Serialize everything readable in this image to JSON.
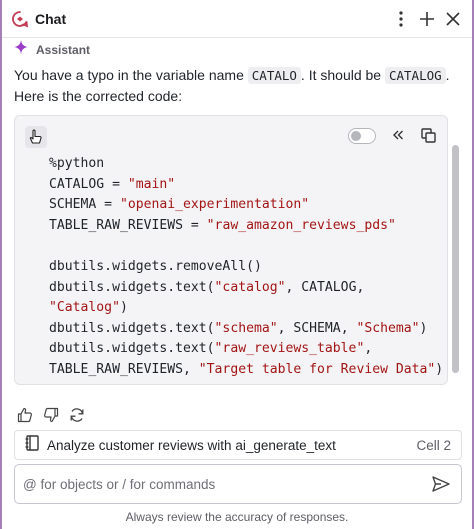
{
  "header": {
    "title": "Chat",
    "menu_icon": "more-vertical-icon",
    "new_chat_icon": "plus-icon",
    "close_icon": "close-icon"
  },
  "assistant": {
    "label": "Assistant",
    "icon": "sparkle-icon"
  },
  "message": {
    "text_before_1": "You have a typo in the variable name ",
    "code_1": "CATALO",
    "text_between": ". It should be ",
    "code_2": "CATALOG",
    "text_after": ". Here is the corrected code:"
  },
  "code_block": {
    "lines": [
      [
        {
          "t": "%python",
          "s": "plain"
        }
      ],
      [
        {
          "t": "CATALOG = ",
          "s": "plain"
        },
        {
          "t": "\"main\"",
          "s": "str"
        }
      ],
      [
        {
          "t": "SCHEMA = ",
          "s": "plain"
        },
        {
          "t": "\"openai_experimentation\"",
          "s": "str"
        }
      ],
      [
        {
          "t": "TABLE_RAW_REVIEWS = ",
          "s": "plain"
        },
        {
          "t": "\"raw_amazon_reviews_pds\"",
          "s": "str"
        }
      ],
      [
        {
          "t": "",
          "s": "plain"
        }
      ],
      [
        {
          "t": "dbutils.widgets.removeAll()",
          "s": "plain"
        }
      ],
      [
        {
          "t": "dbutils.widgets.text(",
          "s": "plain"
        },
        {
          "t": "\"catalog\"",
          "s": "str"
        },
        {
          "t": ", CATALOG,",
          "s": "plain"
        }
      ],
      [
        {
          "t": "\"Catalog\"",
          "s": "str"
        },
        {
          "t": ")",
          "s": "plain"
        }
      ],
      [
        {
          "t": "dbutils.widgets.text(",
          "s": "plain"
        },
        {
          "t": "\"schema\"",
          "s": "str"
        },
        {
          "t": ", SCHEMA, ",
          "s": "plain"
        },
        {
          "t": "\"Schema\"",
          "s": "str"
        },
        {
          "t": ")",
          "s": "plain"
        }
      ],
      [
        {
          "t": "dbutils.widgets.text(",
          "s": "plain"
        },
        {
          "t": "\"raw_reviews_table\"",
          "s": "str"
        },
        {
          "t": ",",
          "s": "plain"
        }
      ],
      [
        {
          "t": "TABLE_RAW_REVIEWS, ",
          "s": "plain"
        },
        {
          "t": "\"Target table for Review Data\"",
          "s": "str"
        },
        {
          "t": ")",
          "s": "plain"
        }
      ]
    ],
    "toggle_state": "off",
    "insert_icon": "insert-cursor-icon",
    "collapse_icon": "double-chevron-left-icon",
    "copy_icon": "copy-icon"
  },
  "feedback": {
    "thumbs_up_icon": "thumbs-up-icon",
    "thumbs_down_icon": "thumbs-down-icon",
    "regenerate_icon": "refresh-icon"
  },
  "cell_reference": {
    "icon": "notebook-icon",
    "label": "Analyze customer reviews with ai_generate_text",
    "cell": "Cell 2"
  },
  "input": {
    "placeholder": "@ for objects or / for commands",
    "value": "",
    "send_icon": "send-icon"
  },
  "disclaimer": "Always review the accuracy of responses."
}
